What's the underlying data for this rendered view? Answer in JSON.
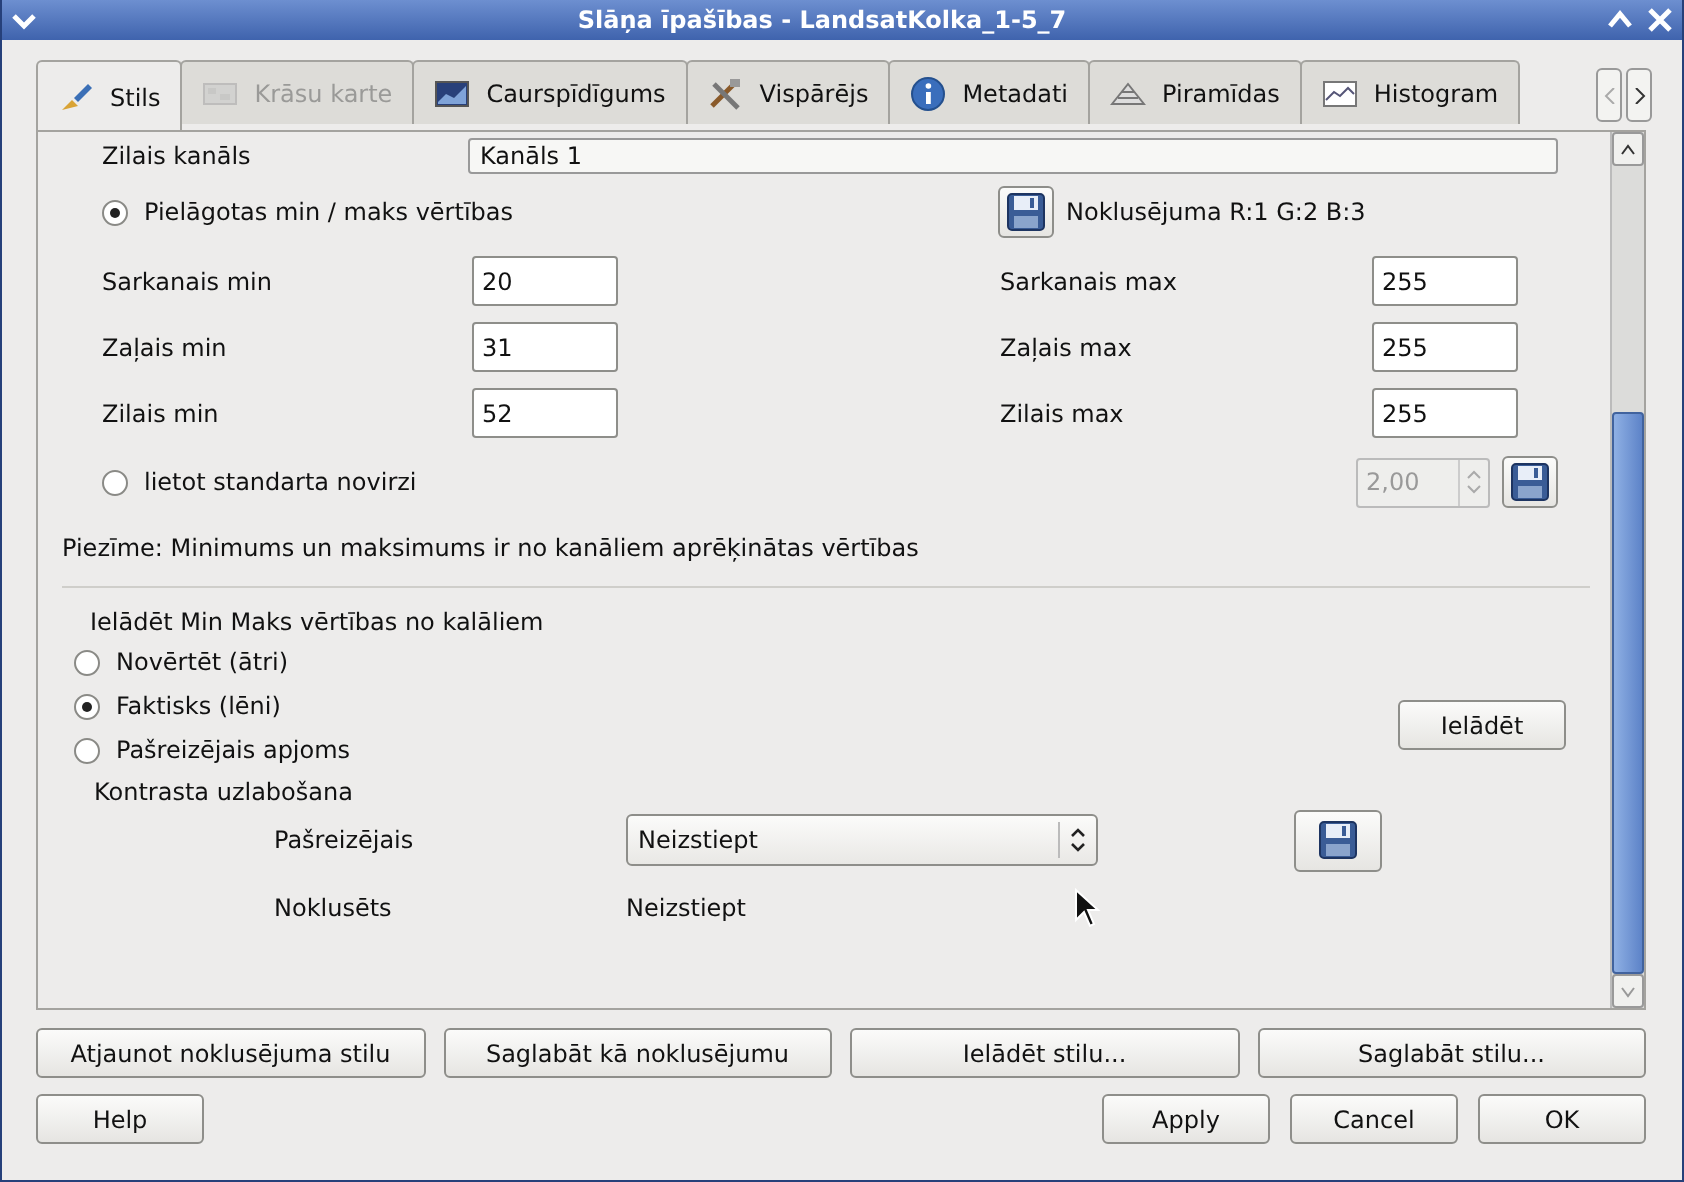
{
  "window": {
    "title": "Slāņa īpašības - LandsatKolka_1-5_7"
  },
  "tabs": [
    {
      "label": "Stils",
      "selected": true,
      "disabled": false
    },
    {
      "label": "Krāsu karte",
      "selected": false,
      "disabled": true
    },
    {
      "label": "Caurspīdīgums",
      "selected": false,
      "disabled": false
    },
    {
      "label": "Vispārējs",
      "selected": false,
      "disabled": false
    },
    {
      "label": "Metadati",
      "selected": false,
      "disabled": false
    },
    {
      "label": "Piramīdas",
      "selected": false,
      "disabled": false
    },
    {
      "label": "Histogram",
      "selected": false,
      "disabled": false
    }
  ],
  "band_row": {
    "label": "Zilais kanāls",
    "value": "Kanāls 1"
  },
  "custom_minmax": {
    "label": "Pielāgotas min / maks vērtības",
    "selected": true
  },
  "default_bands": "Noklusējuma R:1 G:2 B:3",
  "min_fields": [
    {
      "label": "Sarkanais min",
      "value": "20"
    },
    {
      "label": "Zaļais min",
      "value": "31"
    },
    {
      "label": "Zilais min",
      "value": "52"
    }
  ],
  "max_fields": [
    {
      "label": "Sarkanais max",
      "value": "255"
    },
    {
      "label": "Zaļais max",
      "value": "255"
    },
    {
      "label": "Zilais max",
      "value": "255"
    }
  ],
  "stddev": {
    "label": "lietot standarta novirzi",
    "selected": false,
    "value": "2,00",
    "disabled": true
  },
  "note": "Piezīme: Minimums un maksimums ir no kanāliem aprēķinātas vērtības",
  "load_minmax": {
    "title": "Ielādēt Min Maks vērtības no kalāliem",
    "options": [
      {
        "label": "Novērtēt (ātri)",
        "selected": false
      },
      {
        "label": "Faktisks (lēni)",
        "selected": true
      },
      {
        "label": "Pašreizējais apjoms",
        "selected": false
      }
    ],
    "button": "Ielādēt"
  },
  "contrast": {
    "title": "Kontrasta uzlabošana",
    "current_label": "Pašreizējais",
    "current_value": "Neizstiept",
    "default_label": "Noklusēts",
    "default_value": "Neizstiept"
  },
  "style_buttons": [
    "Atjaunot noklusējuma stilu",
    "Saglabāt kā noklusējumu",
    "Ielādēt stilu...",
    "Saglabāt stilu..."
  ],
  "dialog_buttons": [
    {
      "label": "Help",
      "kind": "left"
    },
    {
      "label": "Apply",
      "kind": "right"
    },
    {
      "label": "Cancel",
      "kind": "right"
    },
    {
      "label": "OK",
      "kind": "right"
    }
  ]
}
